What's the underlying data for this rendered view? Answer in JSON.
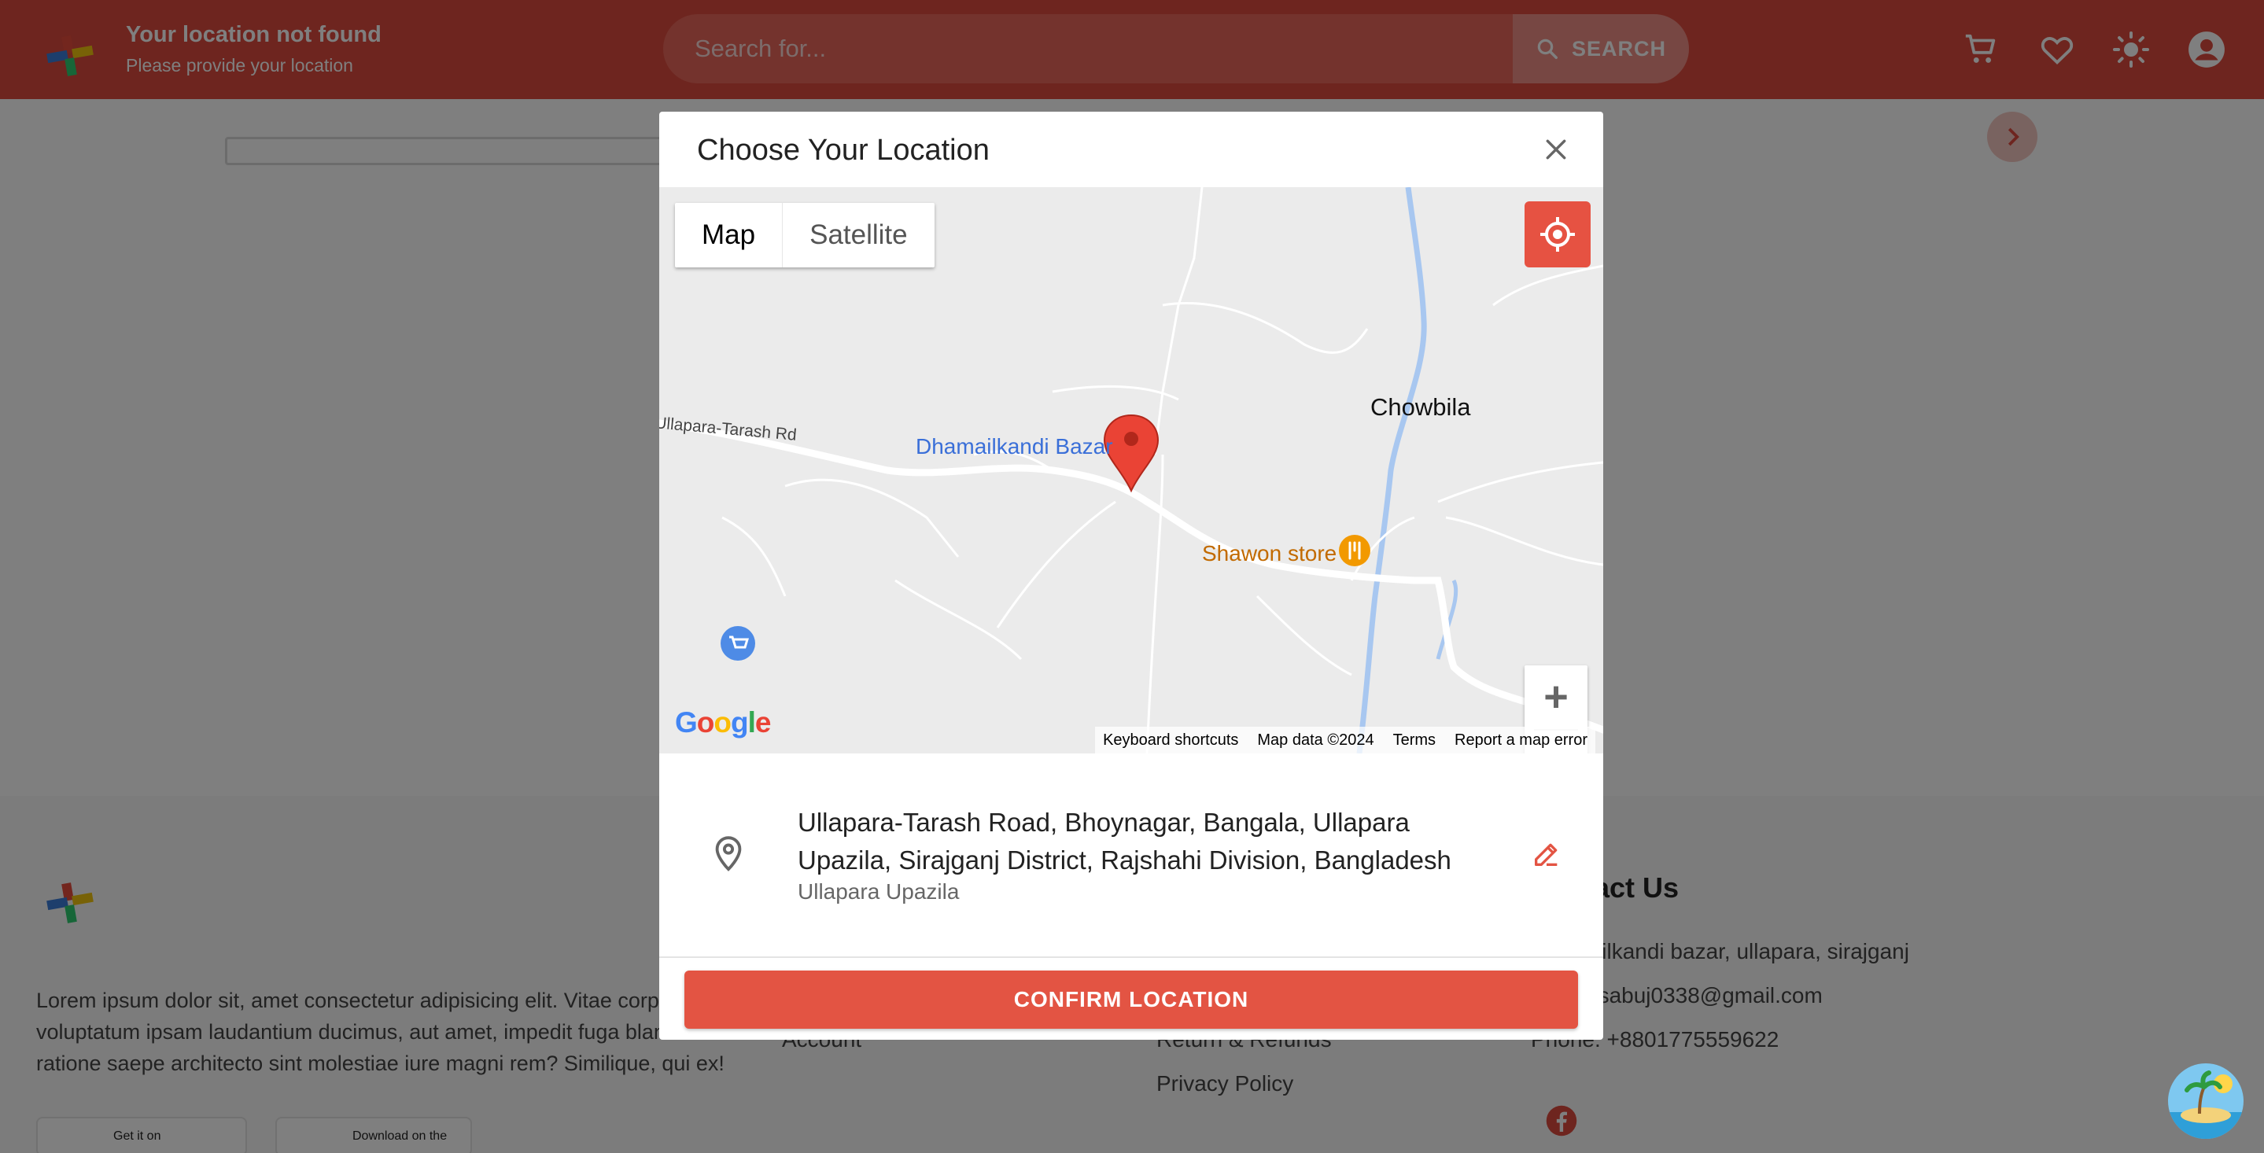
{
  "header": {
    "location_title": "Your location not found",
    "location_subtitle": "Please provide your location",
    "search_placeholder": "Search for...",
    "search_button": "SEARCH",
    "icons": [
      "cart-icon",
      "heart-icon",
      "sun-icon",
      "account-icon"
    ]
  },
  "footer": {
    "about": "Lorem ipsum dolor sit, amet consectetur adipisicing elit. Vitae corporis voluptatum ipsam laudantium ducimus, aut amet, impedit fuga blanditiis ratione saepe architecto sint molestiae iure magni rem? Similique, qui ex!",
    "google_play_top": "Get it on",
    "app_store_top": "Download on the",
    "link_account": "Account",
    "link_returns": "Return & Refunds",
    "link_privacy": "Privacy Policy",
    "contact_heading": "Contact Us",
    "contact_address": "Dhamailkandi bazar, ullapara, sirajganj",
    "contact_email": "Email: sabuj0338@gmail.com",
    "contact_phone": "Phone: +8801775559622"
  },
  "dialog": {
    "title": "Choose Your Location",
    "map": {
      "type_map": "Map",
      "type_satellite": "Satellite",
      "zoom_in": "+",
      "zoom_out": "−",
      "labels": {
        "road": "Ullapara-Tarash Rd",
        "bazar": "Dhamailkandi Bazar",
        "village": "Chowbila",
        "store": "Shawon store"
      },
      "google": "Google",
      "attribution": {
        "shortcuts": "Keyboard shortcuts",
        "data": "Map data ©2024",
        "terms": "Terms",
        "report": "Report a map error"
      }
    },
    "address": {
      "full": "Ullapara-Tarash Road, Bhoynagar, Bangala, Ullapara Upazila, Sirajganj District, Rajshahi Division, Bangladesh",
      "area": "Ullapara Upazila"
    },
    "confirm_button": "CONFIRM LOCATION"
  },
  "colors": {
    "brand": "#dc4b3e",
    "confirm": "#e35443",
    "overlay": "rgba(0,0,0,0.5)"
  }
}
